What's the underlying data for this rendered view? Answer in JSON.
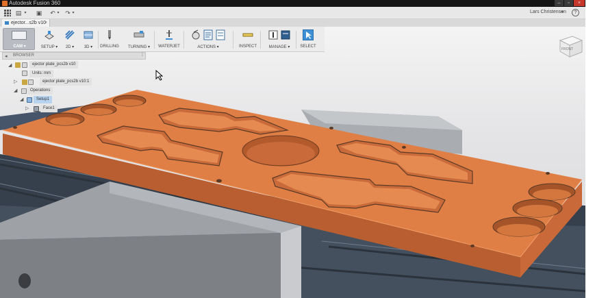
{
  "window": {
    "title": "Autodesk Fusion 360"
  },
  "user": {
    "name": "Lars Christensen"
  },
  "document_tab": {
    "label": "ejector...s2b v10",
    "close": "×"
  },
  "toolbar": {
    "workspace": "CAM",
    "items": [
      {
        "label": "SETUP",
        "dropdown": true
      },
      {
        "label": "2D",
        "dropdown": true
      },
      {
        "label": "3D",
        "dropdown": true
      },
      {
        "label": "DRILLING",
        "dropdown": false
      },
      {
        "label": "TURNING",
        "dropdown": true
      },
      {
        "label": "WATERJET",
        "dropdown": false
      },
      {
        "label": "ACTIONS",
        "dropdown": true
      },
      {
        "label": "INSPECT",
        "dropdown": false
      },
      {
        "label": "MANAGE",
        "dropdown": true
      },
      {
        "label": "SELECT",
        "dropdown": false
      }
    ]
  },
  "browser": {
    "title": "BROWSER",
    "nodes": {
      "root": "ejector plate_pcs2b v10",
      "units": "Units: mm",
      "component": "ejector plate_pcs2b v10:1",
      "operations": "Operations",
      "setup": "Setup1",
      "face": "Face1"
    }
  },
  "viewcube": {
    "label": "FRONT"
  },
  "colors": {
    "part": "#e07f45",
    "part_side": "#c9693a",
    "vise": "#8a8d91",
    "machine": "#3d4a58",
    "selection": "#b7d3ef",
    "accent": "#3f8fd4"
  }
}
